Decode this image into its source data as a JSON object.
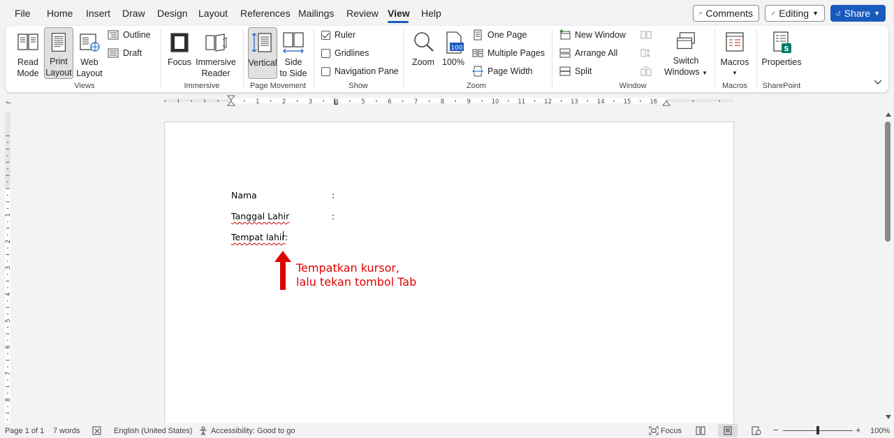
{
  "menu": {
    "items": [
      "File",
      "Home",
      "Insert",
      "Draw",
      "Design",
      "Layout",
      "References",
      "Mailings",
      "Review",
      "View",
      "Help"
    ],
    "active": "View",
    "comments_label": "Comments",
    "editing_label": "Editing",
    "share_label": "Share"
  },
  "ribbon": {
    "views": {
      "label": "Views",
      "read_mode": [
        "Read",
        "Mode"
      ],
      "print_layout": [
        "Print",
        "Layout"
      ],
      "web_layout": [
        "Web",
        "Layout"
      ],
      "outline": "Outline",
      "draft": "Draft"
    },
    "immersive": {
      "label": "Immersive",
      "focus": "Focus",
      "immersive_reader": [
        "Immersive",
        "Reader"
      ]
    },
    "page_movement": {
      "label": "Page Movement",
      "vertical": "Vertical",
      "side_to_side": [
        "Side",
        "to Side"
      ]
    },
    "show": {
      "label": "Show",
      "ruler": "Ruler",
      "ruler_checked": true,
      "gridlines": "Gridlines",
      "gridlines_checked": false,
      "navigation_pane": "Navigation Pane",
      "navigation_pane_checked": false
    },
    "zoom": {
      "label": "Zoom",
      "zoom": "Zoom",
      "hundred": "100%",
      "hundred_icon_text": "100",
      "one_page": "One Page",
      "multiple_pages": "Multiple Pages",
      "page_width": "Page Width"
    },
    "window": {
      "label": "Window",
      "new_window": "New Window",
      "arrange_all": "Arrange All",
      "split": "Split",
      "switch_windows": [
        "Switch",
        "Windows"
      ]
    },
    "macros": {
      "label": "Macros",
      "macros": "Macros"
    },
    "sharepoint": {
      "label": "SharePoint",
      "properties": "Properties",
      "icon_letter": "S"
    }
  },
  "ruler_numbers": [
    "1",
    "2",
    "3",
    "4",
    "5",
    "6",
    "7",
    "8",
    "9",
    "10",
    "11",
    "12",
    "13",
    "14",
    "15",
    "16"
  ],
  "vruler_numbers": [
    "1",
    "2",
    "3",
    "4",
    "5",
    "6",
    "7",
    "8"
  ],
  "document": {
    "lines": [
      {
        "label": "Nama",
        "colon": ":"
      },
      {
        "label": "Tanggal Lahir",
        "colon": ":"
      },
      {
        "label": "Tempat lahir",
        "colon": ":"
      }
    ],
    "annotation_line1": "Tempatkan kursor,",
    "annotation_line2": "lalu tekan tombol Tab"
  },
  "status": {
    "page": "Page 1 of 1",
    "words": "7 words",
    "language": "English (United States)",
    "accessibility": "Accessibility: Good to go",
    "focus": "Focus",
    "zoom_level": "100%"
  },
  "colors": {
    "accent": "#185abd",
    "annotation": "#e00000",
    "sharepoint": "#037c6e"
  }
}
